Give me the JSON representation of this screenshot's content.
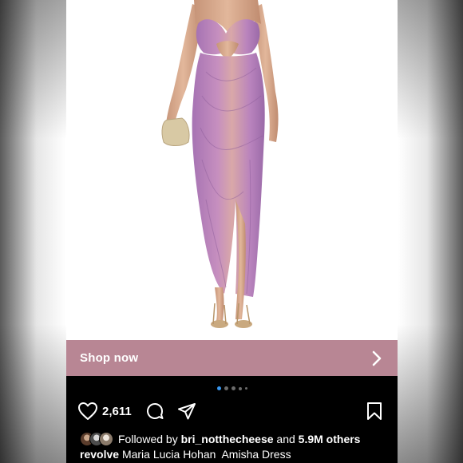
{
  "post": {
    "shop_label": "Shop now",
    "likes": "2,611",
    "carousel": {
      "count": 5,
      "active": 0
    },
    "followed_prefix": "Followed by",
    "followed_user": "bri_notthecheese",
    "followed_and": "and",
    "followed_others": "5.9M others",
    "caption_user": "revolve",
    "caption_text": "Maria Lucia Hohan  Amisha Dress"
  },
  "colors": {
    "shop_bar": "#b88694",
    "dress": "#b07ab8",
    "active_dot": "#3897f0"
  },
  "icons": [
    "heart-icon",
    "comment-icon",
    "share-icon",
    "bookmark-icon",
    "chevron-right-icon"
  ]
}
